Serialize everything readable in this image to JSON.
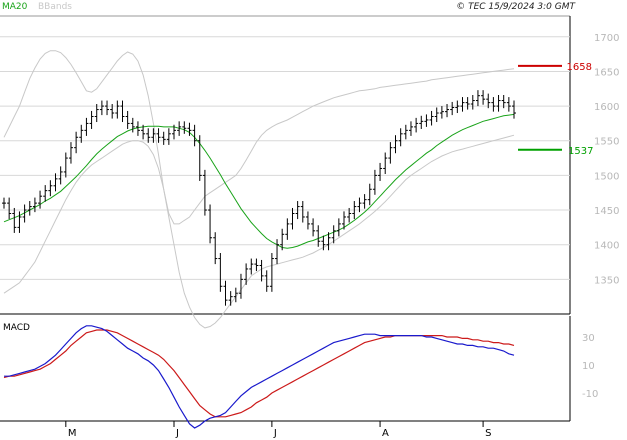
{
  "header": {
    "legend_ma": "MA20",
    "legend_bb": "BBands",
    "copyright": "© TEC 15/9/2024 3:0 GMT"
  },
  "colors": {
    "price": "#000000",
    "ma": "#19a319",
    "bbands": "#c8c8c8",
    "resistance": "#cc0000",
    "support": "#00a000",
    "macd": "#1a1acc",
    "signal": "#cc1a1a",
    "grid": "#d8d8d8",
    "axis_text": "#b8b8b8"
  },
  "chart_data": [
    {
      "type": "line",
      "panel": "price",
      "y_ticks": [
        "1700",
        "1650",
        "1600",
        "1550",
        "1500",
        "1450",
        "1400",
        "1350"
      ],
      "ylim": [
        1300,
        1730
      ],
      "grid": true,
      "x_labels": [
        "M",
        "J",
        "J",
        "A",
        "S"
      ],
      "levels": [
        {
          "label": "1658",
          "value": 1658,
          "role": "resistance"
        },
        {
          "label": "1537",
          "value": 1537,
          "role": "support"
        }
      ],
      "close": [
        1460,
        1445,
        1425,
        1440,
        1450,
        1455,
        1460,
        1470,
        1478,
        1485,
        1495,
        1505,
        1525,
        1540,
        1555,
        1565,
        1575,
        1585,
        1595,
        1600,
        1595,
        1590,
        1600,
        1585,
        1575,
        1570,
        1565,
        1560,
        1555,
        1560,
        1555,
        1552,
        1560,
        1565,
        1570,
        1568,
        1565,
        1550,
        1500,
        1450,
        1410,
        1380,
        1340,
        1320,
        1325,
        1330,
        1350,
        1365,
        1372,
        1370,
        1355,
        1340,
        1380,
        1400,
        1415,
        1430,
        1445,
        1455,
        1440,
        1430,
        1420,
        1405,
        1400,
        1410,
        1420,
        1430,
        1440,
        1445,
        1455,
        1460,
        1465,
        1480,
        1500,
        1510,
        1525,
        1540,
        1550,
        1560,
        1565,
        1570,
        1575,
        1578,
        1580,
        1585,
        1590,
        1592,
        1595,
        1598,
        1600,
        1605,
        1603,
        1608,
        1615,
        1610,
        1605,
        1600,
        1608,
        1605,
        1600,
        1590
      ],
      "series": [
        {
          "name": "MA20",
          "values": [
            1433,
            1436,
            1439,
            1442,
            1446,
            1450,
            1454,
            1458,
            1463,
            1467,
            1472,
            1477,
            1484,
            1491,
            1498,
            1506,
            1514,
            1523,
            1531,
            1538,
            1544,
            1550,
            1556,
            1560,
            1564,
            1567,
            1569,
            1570,
            1571,
            1571,
            1571,
            1570,
            1570,
            1570,
            1568,
            1566,
            1562,
            1555,
            1546,
            1536,
            1525,
            1513,
            1501,
            1488,
            1476,
            1464,
            1452,
            1442,
            1432,
            1424,
            1416,
            1409,
            1404,
            1400,
            1396,
            1395,
            1396,
            1398,
            1401,
            1404,
            1406,
            1409,
            1412,
            1415,
            1418,
            1421,
            1425,
            1430,
            1435,
            1441,
            1447,
            1454,
            1462,
            1470,
            1478,
            1486,
            1494,
            1501,
            1508,
            1514,
            1520,
            1526,
            1532,
            1537,
            1543,
            1548,
            1553,
            1558,
            1562,
            1566,
            1569,
            1572,
            1575,
            1578,
            1580,
            1582,
            1584,
            1586,
            1587,
            1588
          ]
        },
        {
          "name": "BBands",
          "values": [
            1555,
            1570,
            1585,
            1600,
            1620,
            1640,
            1655,
            1668,
            1676,
            1680,
            1680,
            1677,
            1670,
            1660,
            1648,
            1635,
            1622,
            1620,
            1625,
            1635,
            1645,
            1655,
            1665,
            1673,
            1678,
            1675,
            1665,
            1645,
            1615,
            1575,
            1530,
            1480,
            1445,
            1430,
            1430,
            1435,
            1440,
            1450,
            1460,
            1470,
            1475,
            1480,
            1485,
            1490,
            1495,
            1500,
            1510,
            1522,
            1535,
            1548,
            1558,
            1565,
            1570,
            1574,
            1577,
            1580,
            1584,
            1588,
            1592,
            1596,
            1600,
            1603,
            1606,
            1609,
            1612,
            1614,
            1616,
            1618,
            1620,
            1622,
            1623,
            1624,
            1625,
            1627,
            1628,
            1629,
            1630,
            1631,
            1632,
            1633,
            1634,
            1635,
            1636,
            1638,
            1639,
            1640,
            1641,
            1642,
            1643,
            1644,
            1645,
            1646,
            1647,
            1648,
            1649,
            1650,
            1651,
            1652,
            1653,
            1654
          ]
        }
      ],
      "bb_lower": [
        1330,
        1335,
        1340,
        1345,
        1355,
        1365,
        1375,
        1390,
        1405,
        1420,
        1435,
        1450,
        1465,
        1478,
        1490,
        1500,
        1508,
        1515,
        1520,
        1525,
        1530,
        1535,
        1540,
        1545,
        1548,
        1550,
        1550,
        1548,
        1542,
        1530,
        1510,
        1480,
        1440,
        1400,
        1360,
        1330,
        1310,
        1295,
        1285,
        1280,
        1282,
        1287,
        1295,
        1305,
        1315,
        1325,
        1335,
        1345,
        1355,
        1360,
        1365,
        1368,
        1370,
        1372,
        1374,
        1376,
        1378,
        1380,
        1382,
        1385,
        1388,
        1392,
        1396,
        1400,
        1405,
        1410,
        1415,
        1420,
        1425,
        1430,
        1436,
        1442,
        1448,
        1455,
        1462,
        1470,
        1478,
        1486,
        1494,
        1500,
        1505,
        1510,
        1515,
        1520,
        1524,
        1528,
        1531,
        1534,
        1536,
        1538,
        1540,
        1542,
        1544,
        1546,
        1548,
        1550,
        1552,
        1554,
        1556,
        1558
      ]
    },
    {
      "type": "line",
      "panel": "MACD",
      "title": "MACD",
      "y_ticks": [
        "30",
        "10",
        "-10"
      ],
      "ylim": [
        -30,
        45
      ],
      "series": [
        {
          "name": "MACD",
          "values": [
            2,
            2,
            3,
            4,
            5,
            6,
            7,
            9,
            11,
            14,
            17,
            21,
            25,
            29,
            33,
            36,
            38,
            38,
            37,
            36,
            34,
            31,
            28,
            25,
            22,
            20,
            18,
            15,
            13,
            10,
            6,
            0,
            -6,
            -13,
            -20,
            -26,
            -32,
            -35,
            -33,
            -30,
            -28,
            -27,
            -26,
            -24,
            -20,
            -16,
            -12,
            -9,
            -6,
            -4,
            -2,
            0,
            2,
            4,
            6,
            8,
            10,
            12,
            14,
            16,
            18,
            20,
            22,
            24,
            26,
            27,
            28,
            29,
            30,
            31,
            32,
            32,
            32,
            31,
            31,
            31,
            31,
            31,
            31,
            31,
            31,
            31,
            30,
            30,
            29,
            28,
            27,
            26,
            25,
            25,
            24,
            24,
            23,
            23,
            22,
            22,
            21,
            20,
            18,
            17
          ]
        },
        {
          "name": "Signal",
          "values": [
            1,
            2,
            2,
            3,
            4,
            5,
            6,
            7,
            9,
            11,
            14,
            17,
            20,
            24,
            27,
            30,
            33,
            34,
            35,
            35,
            35,
            34,
            33,
            31,
            29,
            27,
            25,
            23,
            21,
            19,
            17,
            14,
            10,
            6,
            1,
            -4,
            -9,
            -14,
            -19,
            -22,
            -25,
            -27,
            -27,
            -27,
            -26,
            -25,
            -24,
            -22,
            -20,
            -17,
            -15,
            -13,
            -10,
            -8,
            -6,
            -4,
            -2,
            0,
            2,
            4,
            6,
            8,
            10,
            12,
            14,
            16,
            18,
            20,
            22,
            24,
            26,
            27,
            28,
            29,
            30,
            30,
            31,
            31,
            31,
            31,
            31,
            31,
            31,
            31,
            31,
            31,
            30,
            30,
            30,
            29,
            29,
            28,
            28,
            27,
            27,
            26,
            26,
            25,
            25,
            24
          ]
        }
      ]
    }
  ]
}
